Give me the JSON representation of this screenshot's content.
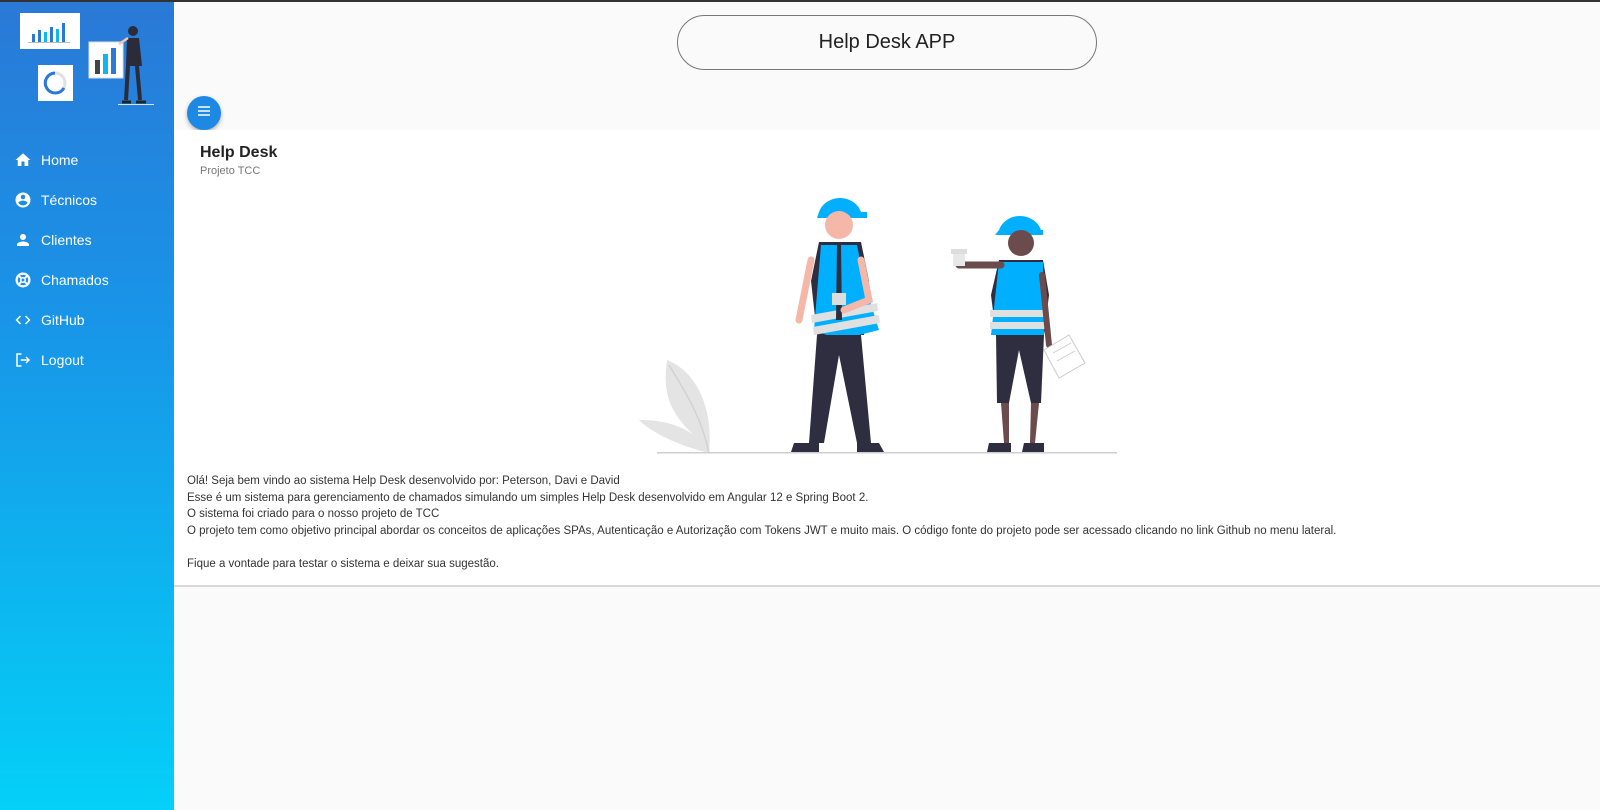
{
  "header": {
    "app_title": "Help Desk APP"
  },
  "sidebar": {
    "items": [
      {
        "label": "Home",
        "icon": "home-icon"
      },
      {
        "label": "Técnicos",
        "icon": "account-circle-icon"
      },
      {
        "label": "Clientes",
        "icon": "person-icon"
      },
      {
        "label": "Chamados",
        "icon": "lifebuoy-icon"
      },
      {
        "label": "GitHub",
        "icon": "code-icon"
      },
      {
        "label": "Logout",
        "icon": "logout-icon"
      }
    ]
  },
  "card": {
    "title": "Help Desk",
    "subtitle": "Projeto TCC",
    "paragraphs": [
      "Olá! Seja bem vindo ao sistema Help Desk desenvolvido por: Peterson, Davi e David",
      "Esse é um sistema para gerenciamento de chamados simulando um simples Help Desk desenvolvido em Angular 12 e Spring Boot 2.",
      "O sistema foi criado para o nosso projeto de TCC",
      "O projeto tem como objetivo principal abordar os conceitos de aplicações SPAs, Autenticação e Autorização com Tokens JWT e muito mais. O código fonte do projeto pode ser acessado clicando no link Github no menu lateral.",
      "Fique a vontade para testar o sistema e deixar sua sugestão."
    ]
  },
  "colors": {
    "sidebar_top": "#2a79d6",
    "sidebar_bottom": "#04d0f8",
    "accent": "#1e88e5",
    "helmet": "#00b0ff"
  }
}
